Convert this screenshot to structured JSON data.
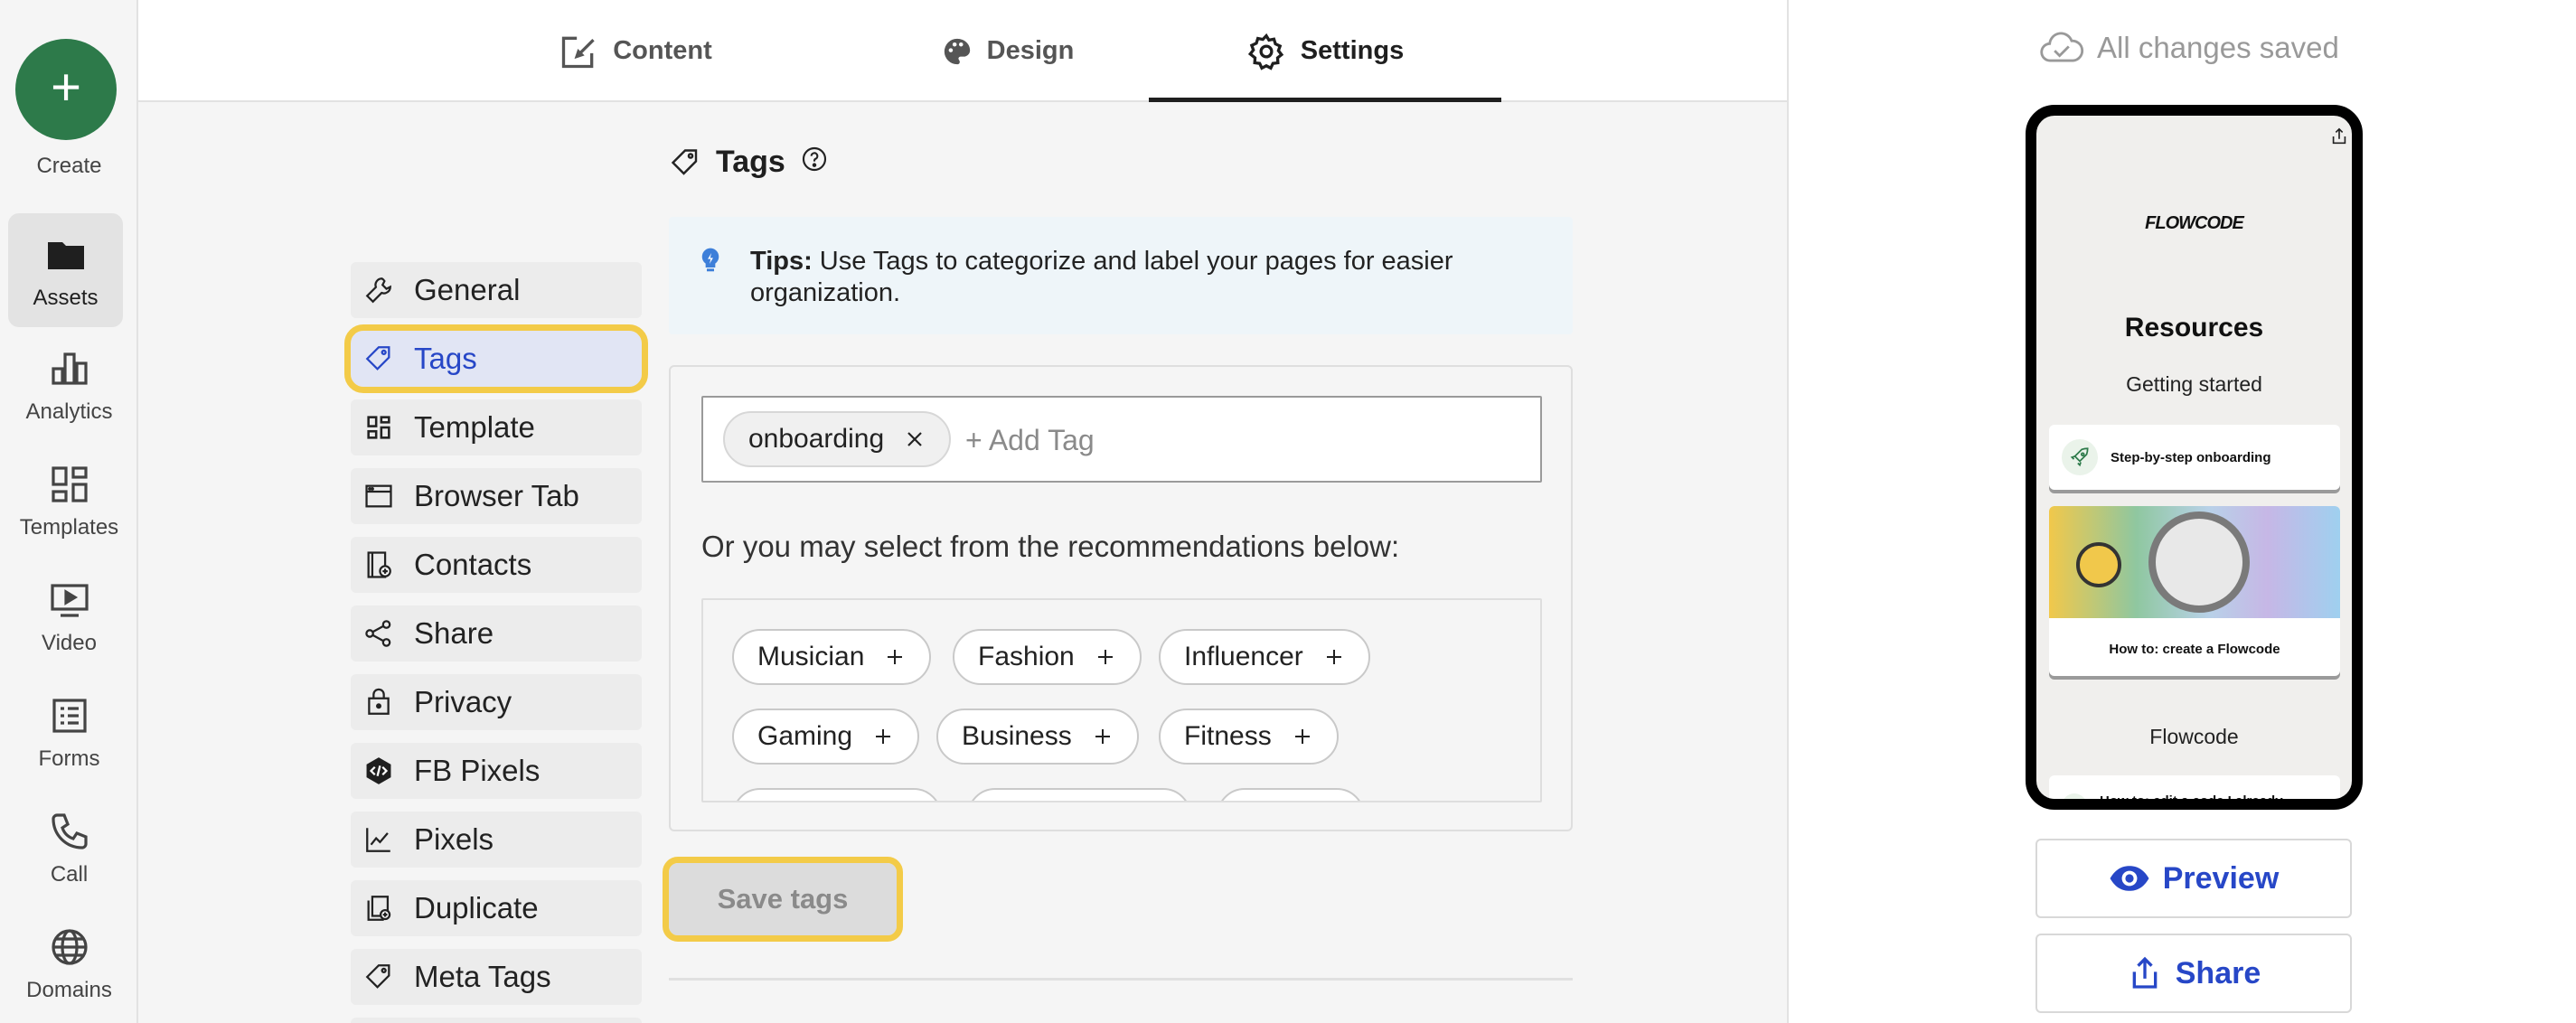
{
  "rail": {
    "create": "Create",
    "items": [
      "Assets",
      "Analytics",
      "Templates",
      "Video",
      "Forms",
      "Call",
      "Domains"
    ]
  },
  "tabs": [
    {
      "label": "Content",
      "icon": "edit-icon"
    },
    {
      "label": "Design",
      "icon": "palette-icon"
    },
    {
      "label": "Settings",
      "icon": "gear-icon",
      "active": true
    }
  ],
  "settings_nav": [
    {
      "label": "General",
      "icon": "wrench-icon"
    },
    {
      "label": "Tags",
      "icon": "tag-icon",
      "active": true
    },
    {
      "label": "Template",
      "icon": "template-icon"
    },
    {
      "label": "Browser Tab",
      "icon": "browser-icon"
    },
    {
      "label": "Contacts",
      "icon": "contacts-icon"
    },
    {
      "label": "Share",
      "icon": "share-icon"
    },
    {
      "label": "Privacy",
      "icon": "lock-icon"
    },
    {
      "label": "FB Pixels",
      "icon": "code-icon"
    },
    {
      "label": "Pixels",
      "icon": "chart-line-icon"
    },
    {
      "label": "Duplicate",
      "icon": "duplicate-icon"
    },
    {
      "label": "Meta Tags",
      "icon": "tag-icon"
    }
  ],
  "tags_section": {
    "title": "Tags",
    "tips_bold": "Tips:",
    "tips_text": " Use Tags to categorize and label your pages for easier organization.",
    "selected_tags": [
      "onboarding"
    ],
    "add_placeholder": "+ Add Tag",
    "recommend_label": "Or you may select from the recommendations below:",
    "recommendations": [
      "Musician",
      "Fashion",
      "Influencer",
      "Gaming",
      "Business",
      "Fitness"
    ],
    "save_label": "Save tags"
  },
  "right_panel": {
    "saved_status": "All changes saved",
    "preview": {
      "brand": "FLOWCODE",
      "title": "Resources",
      "section1": "Getting started",
      "card1": "Step-by-step onboarding",
      "card2": "How to: create a Flowcode",
      "section2": "Flowcode",
      "card3": "How to: edit a code I already"
    },
    "preview_button": "Preview",
    "share_button": "Share"
  },
  "colors": {
    "accent": "#2747c7",
    "highlight": "#f3cb48",
    "create": "#2d7a4a"
  }
}
